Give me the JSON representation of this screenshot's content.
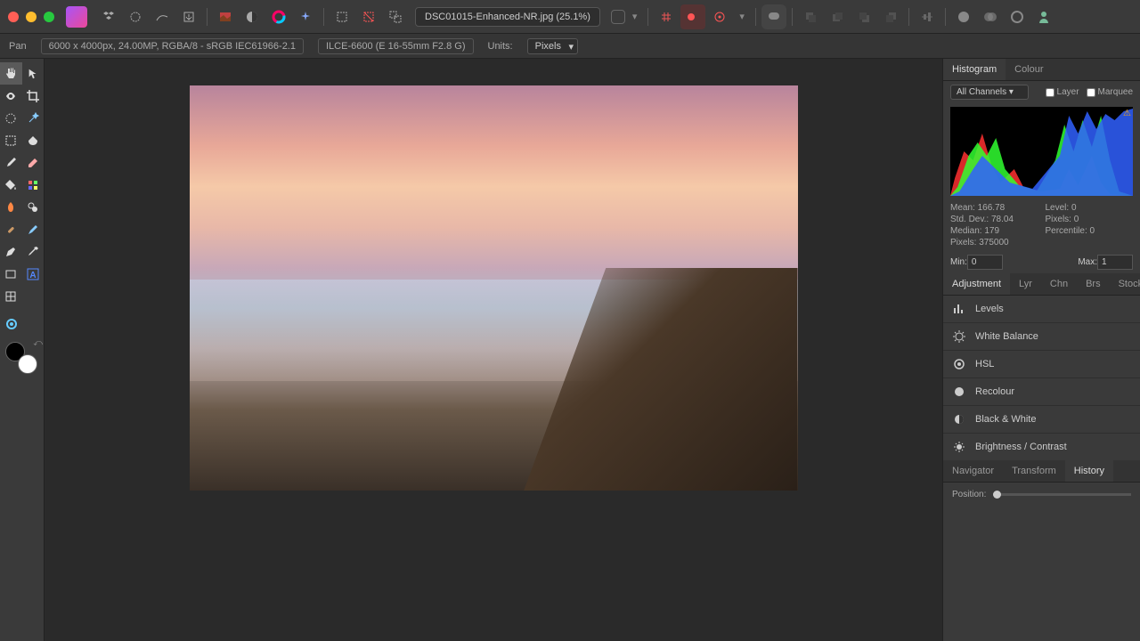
{
  "title": "DSC01015-Enhanced-NR.jpg (25.1%)",
  "context": {
    "tool_label": "Pan",
    "dims": "6000 x 4000px, 24.00MP, RGBA/8 - sRGB IEC61966-2.1",
    "camera": "ILCE-6600 (E 16-55mm F2.8 G)",
    "units_label": "Units:",
    "units_value": "Pixels"
  },
  "histogram": {
    "tabs": [
      "Histogram",
      "Colour"
    ],
    "channel": "All Channels",
    "layer_label": "Layer",
    "marquee_label": "Marquee",
    "stats": {
      "mean": "Mean: 166.78",
      "level": "Level: 0",
      "stddev": "Std. Dev.: 78.04",
      "pixels_right": "Pixels: 0",
      "median": "Median: 179",
      "percentile": "Percentile: 0",
      "pixels": "Pixels: 375000"
    },
    "min_label": "Min:",
    "min_value": "0",
    "max_label": "Max:",
    "max_value": "1"
  },
  "adjustment": {
    "tabs": [
      "Adjustment",
      "Lyr",
      "Chn",
      "Brs",
      "Stock"
    ],
    "items": [
      {
        "name": "levels",
        "label": "Levels"
      },
      {
        "name": "white-balance",
        "label": "White Balance"
      },
      {
        "name": "hsl",
        "label": "HSL"
      },
      {
        "name": "recolour",
        "label": "Recolour"
      },
      {
        "name": "black-white",
        "label": "Black & White"
      },
      {
        "name": "brightness-contrast",
        "label": "Brightness / Contrast"
      }
    ]
  },
  "bottom_panel": {
    "tabs": [
      "Navigator",
      "Transform",
      "History"
    ],
    "position_label": "Position:"
  }
}
